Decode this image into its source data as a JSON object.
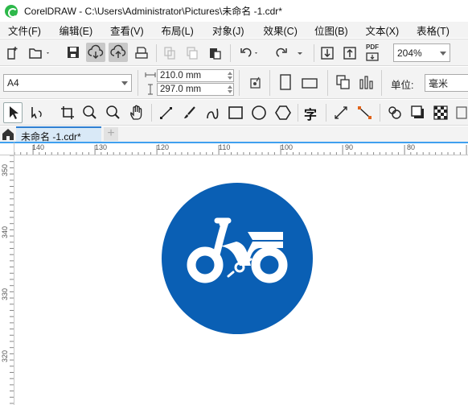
{
  "window": {
    "title": "CorelDRAW - C:\\Users\\Administrator\\Pictures\\未命名 -1.cdr*"
  },
  "menu": [
    "文件(F)",
    "编辑(E)",
    "查看(V)",
    "布局(L)",
    "对象(J)",
    "效果(C)",
    "位图(B)",
    "文本(X)",
    "表格(T)"
  ],
  "toolbar": {
    "zoom": "204%",
    "pdf_label": "PDF"
  },
  "property_bar": {
    "page_size": "A4",
    "width": "210.0 mm",
    "height": "297.0 mm",
    "units_label": "单位:",
    "units_value": "毫米"
  },
  "toolbox": {
    "text_tool_glyph": "字"
  },
  "tabs": {
    "document": "未命名 -1.cdr*",
    "add": "+"
  },
  "rulers": {
    "horizontal": [
      "140",
      "130",
      "120",
      "110",
      "100",
      "90",
      "80"
    ],
    "vertical": [
      "350",
      "340",
      "330",
      "320"
    ]
  },
  "colors": {
    "sign_blue": "#0a5fb4",
    "accent": "#2f7fd1"
  }
}
